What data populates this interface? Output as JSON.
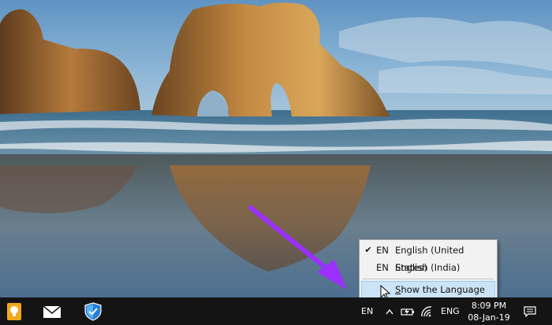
{
  "language_menu": {
    "items": [
      {
        "checked": true,
        "check_mark": "✔",
        "code": "EN",
        "name": "English (United States)"
      },
      {
        "checked": false,
        "check_mark": "",
        "code": "EN",
        "name": "English (India)"
      }
    ],
    "show_bar": {
      "accel": "S",
      "rest": "how the Language bar"
    }
  },
  "taskbar": {
    "apps": [
      "tips-bulb-icon",
      "mail-icon",
      "defender-shield-icon"
    ],
    "tray": {
      "input_indicator": "EN",
      "language": "ENG",
      "time": "8:09 PM",
      "date": "08-Jan-19"
    }
  },
  "colors": {
    "taskbar_bg": "#141414",
    "menu_bg": "#f2f2f2",
    "menu_highlight": "#cce4f7",
    "arrow": "#9b30ff"
  }
}
